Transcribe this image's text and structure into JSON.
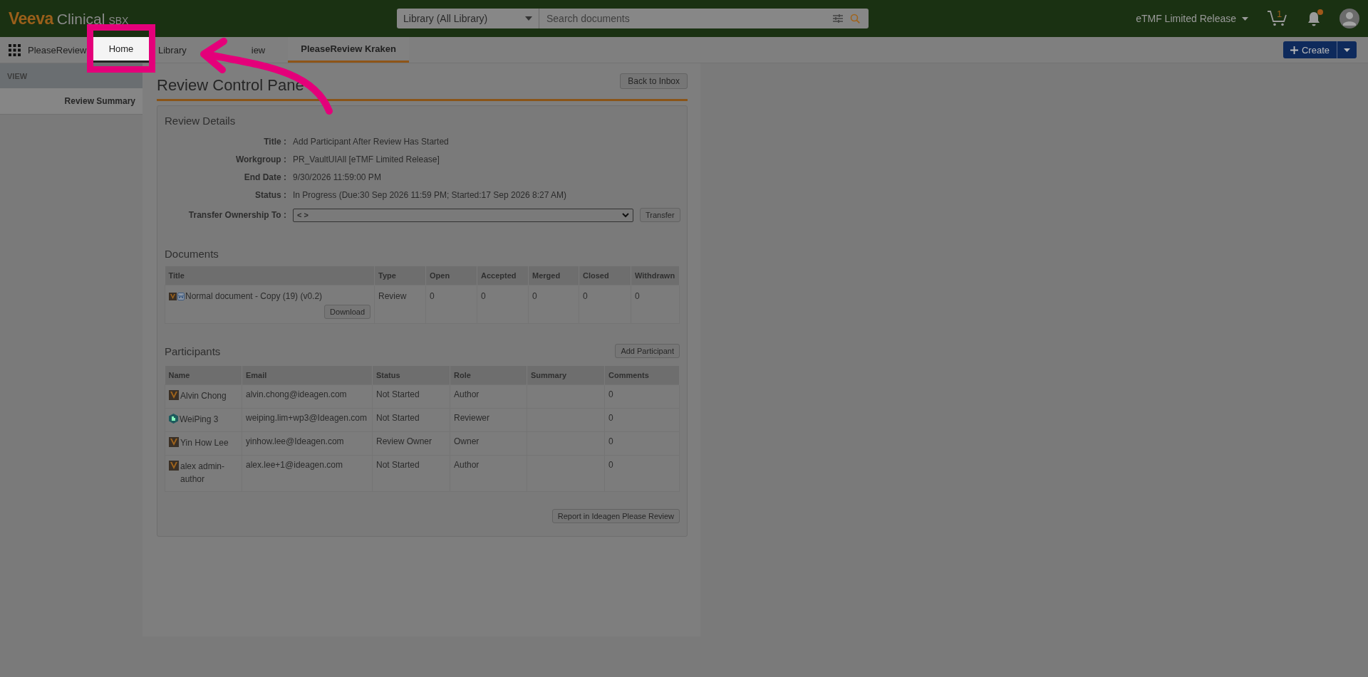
{
  "app_bar": {
    "logo": "Veeva",
    "product": "Clinical",
    "env": "SBX",
    "search_scope": "Library (All Library)",
    "search": {
      "placeholder": "Search documents"
    },
    "vault": "eTMF Limited Release",
    "cart_count": "1",
    "unread": true
  },
  "nav": {
    "app": "PleaseReview",
    "tabs": [
      {
        "label": "Home",
        "selected": false,
        "highlighted": true
      },
      {
        "label": "Library",
        "selected": false,
        "highlighted": false
      },
      {
        "label": "iew",
        "selected": false,
        "highlighted": false
      },
      {
        "label": "PleaseReview Kraken",
        "selected": true,
        "highlighted": false
      }
    ],
    "create_button": "Create"
  },
  "sidebar": {
    "header": "VIEW",
    "items": [
      {
        "label": "Review Summary",
        "selected": true
      }
    ]
  },
  "main": {
    "title": "Review Control Pane",
    "back_button": "Back to Inbox",
    "review_details": {
      "heading": "Review Details",
      "fields": [
        {
          "label": "Title :",
          "value": "Add Participant After Review Has Started"
        },
        {
          "label": "Workgroup :",
          "value": "PR_VaultUIAll [eTMF Limited Release]"
        },
        {
          "label": "End Date :",
          "value": "9/30/2026 11:59:00 PM"
        },
        {
          "label": "Status :",
          "value": "In Progress (Due:30 Sep 2026 11:59 PM; Started:17 Sep 2026 8:27 AM)"
        }
      ],
      "transfer": {
        "label": "Transfer Ownership To :",
        "value": "< >",
        "button": "Transfer"
      }
    },
    "documents": {
      "heading": "Documents",
      "columns": [
        "Title",
        "Type",
        "Open",
        "Accepted",
        "Merged",
        "Closed",
        "Withdrawn"
      ],
      "rows": [
        {
          "title": "Normal document - Copy (19) (v0.2)",
          "type": "Review",
          "open": "0",
          "accepted": "0",
          "merged": "0",
          "closed": "0",
          "withdrawn": "0",
          "download": "Download"
        }
      ]
    },
    "participants": {
      "heading": "Participants",
      "add_button": "Add Participant",
      "columns": [
        "Name",
        "Email",
        "Status",
        "Role",
        "Summary",
        "Comments"
      ],
      "rows": [
        {
          "kind": "vault",
          "name": "Alvin Chong",
          "email": "alvin.chong@ideagen.com",
          "status": "Not Started",
          "role": "Author",
          "comments": "0"
        },
        {
          "kind": "group",
          "name": "WeiPing 3",
          "email": "weiping.lim+wp3@Ideagen.com",
          "status": "Not Started",
          "role": "Reviewer",
          "comments": "0"
        },
        {
          "kind": "vault",
          "name": "Yin How Lee",
          "email": "yinhow.lee@Ideagen.com",
          "status": "Review Owner",
          "role": "Owner",
          "comments": "0"
        },
        {
          "kind": "vault",
          "name": "alex admin-author",
          "email": "alex.lee+1@ideagen.com",
          "status": "Not Started",
          "role": "Author",
          "comments": "0"
        }
      ]
    },
    "report_button": "Report in Ideagen Please Review"
  }
}
